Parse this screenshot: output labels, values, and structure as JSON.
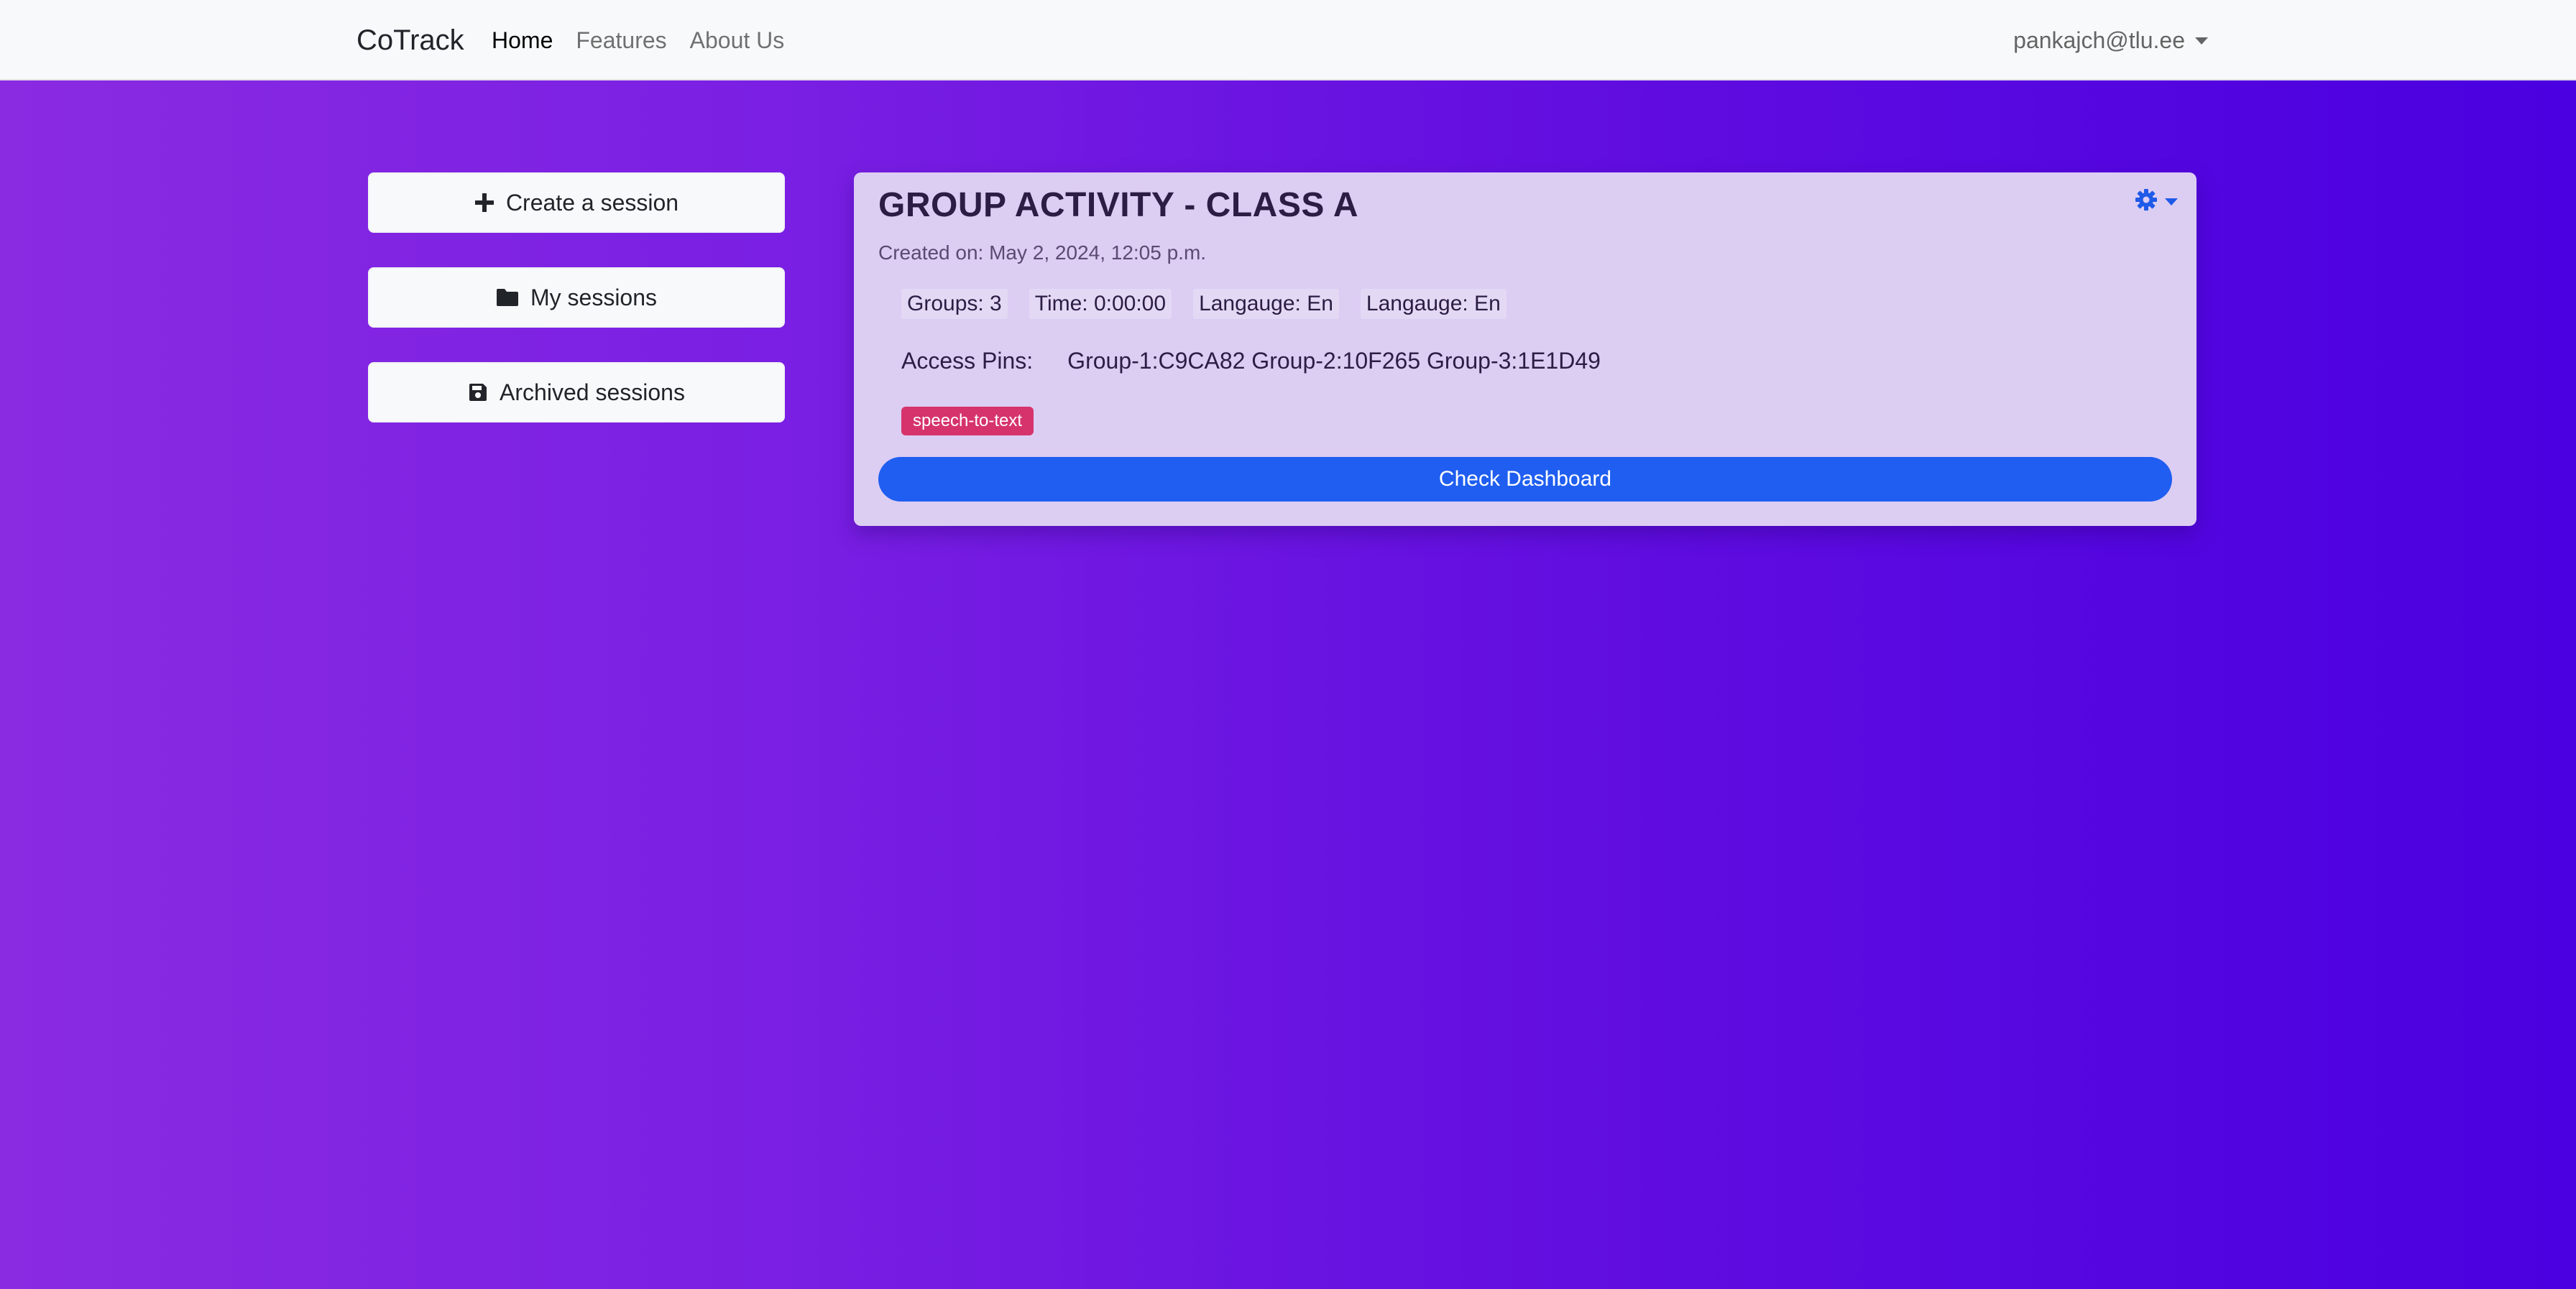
{
  "navbar": {
    "brand": "CoTrack",
    "links": [
      "Home",
      "Features",
      "About Us"
    ],
    "user": "pankajch@tlu.ee"
  },
  "sidebar": {
    "buttons": [
      {
        "label": "Create a session",
        "icon": "plus-icon"
      },
      {
        "label": "My sessions",
        "icon": "folder-icon"
      },
      {
        "label": "Archived sessions",
        "icon": "save-icon"
      }
    ]
  },
  "session_card": {
    "title": "GROUP ACTIVITY - CLASS A",
    "created": "Created on: May 2, 2024, 12:05 p.m.",
    "meta": [
      "Groups: 3",
      "Time: 0:00:00",
      "Langauge: En",
      "Langauge: En"
    ],
    "access_pins_label": "Access Pins:",
    "access_pins": "Group-1:C9CA82 Group-2:10F265 Group-3:1E1D49",
    "badge": "speech-to-text",
    "button_label": "Check Dashboard",
    "settings_icon": "gear-icon"
  },
  "colors": {
    "accent": "#1f5ef0",
    "badge": "#d6336c",
    "gradient_start": "#8a2be2",
    "gradient_end": "#4a00e0",
    "card_bg": "#dccdf3"
  }
}
